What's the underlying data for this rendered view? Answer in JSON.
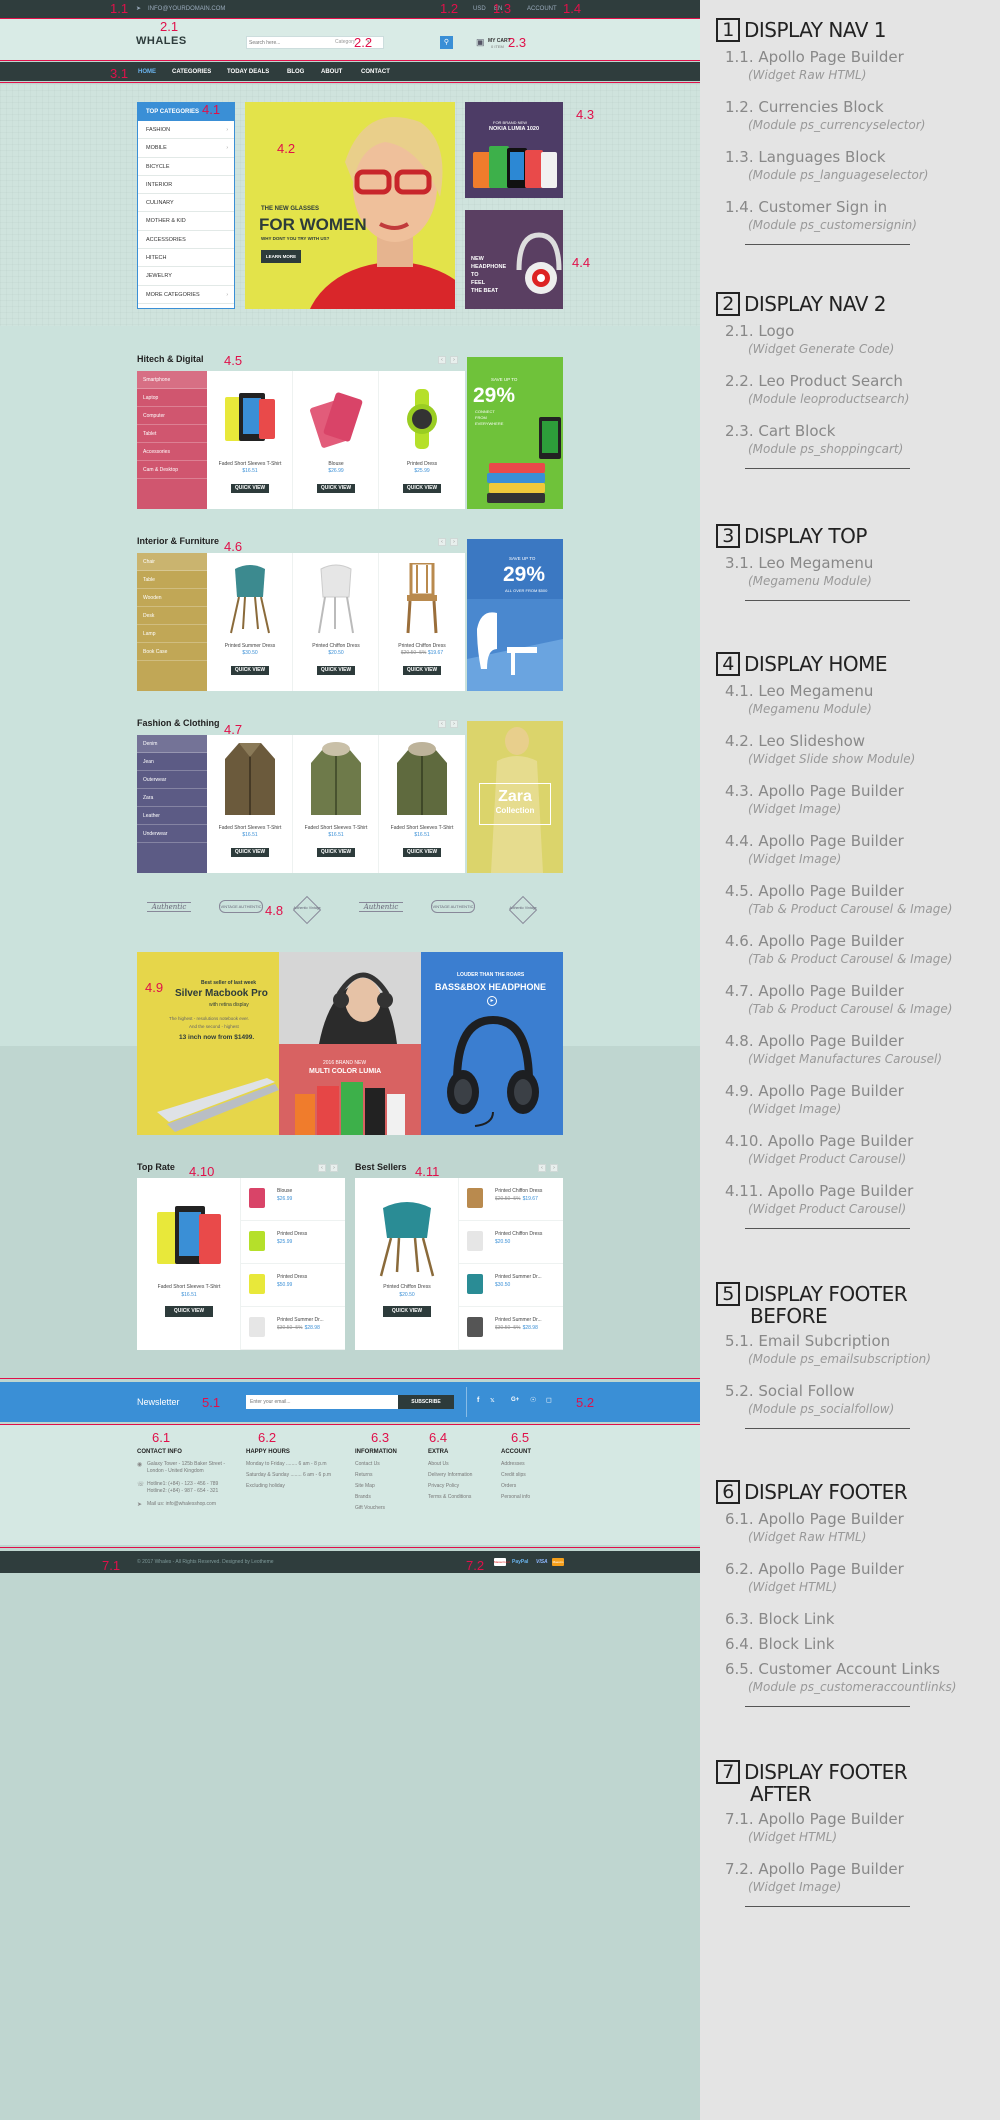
{
  "topbar": {
    "email": "INFO@YOURDOMAIN.COM",
    "currency": "USD",
    "language": "EN",
    "account": "ACCOUNT"
  },
  "header": {
    "logo": "WHALES",
    "search_placeholder": "Search here...",
    "category_label": "Category",
    "cart_label": "MY CART",
    "cart_count": "0 ITEM"
  },
  "menu": {
    "items": [
      "HOME",
      "CATEGORIES",
      "TODAY DEALS",
      "BLOG",
      "ABOUT",
      "CONTACT"
    ]
  },
  "top_categories": {
    "title": "TOP CATEGORIES",
    "items": [
      "FASHION",
      "MOBILE",
      "BICYCLE",
      "INTERIOR",
      "CULINARY",
      "MOTHER & KID",
      "ACCESSORIES",
      "HITECH",
      "JEWELRY",
      "MORE CATEGORIES"
    ]
  },
  "slide": {
    "kicker": "THE NEW GLASSES",
    "headline": "FOR WOMEN",
    "sub": "WHY DONT YOU TRY WITH US?",
    "button": "LEARN MORE"
  },
  "banner_nokia": {
    "kicker": "FOR BRAND NEW",
    "title": "NOKIA LUMIA 1020"
  },
  "banner_headphone": {
    "lines": [
      "NEW",
      "HEADPHONE",
      "TO",
      "FEEL",
      "THE BEAT"
    ]
  },
  "hitech": {
    "title": "Hitech & Digital",
    "cats": [
      "Smartphone",
      "Laptop",
      "Computer",
      "Tablet",
      "Accessories",
      "Cam & Desktop"
    ],
    "products": [
      {
        "name": "Faded Short Sleeves T-Shirt",
        "price": "$16.51"
      },
      {
        "name": "Blouse",
        "price": "$26.99"
      },
      {
        "name": "Printed Dress",
        "price": "$25.99"
      }
    ],
    "promo": {
      "kicker": "SAVE UP TO",
      "value": "29%",
      "sub": [
        "CONNECT",
        "FROM",
        "EVERYWHERE"
      ]
    }
  },
  "interior": {
    "title": "Interior & Furniture",
    "cats": [
      "Chair",
      "Table",
      "Wooden",
      "Desk",
      "Lamp",
      "Book Case"
    ],
    "products": [
      {
        "name": "Printed Summer Dress",
        "price": "$30.50"
      },
      {
        "name": "Printed Chiffon Dress",
        "price": "$20.50"
      },
      {
        "name": "Printed Chiffon Dress",
        "price": "$19.67",
        "old": "$20.50 -5%"
      }
    ],
    "promo": {
      "kicker": "SAVE UP TO",
      "value": "29%",
      "sub": [
        "ALL OVER FROM $500"
      ]
    }
  },
  "fashion": {
    "title": "Fashion & Clothing",
    "cats": [
      "Denim",
      "Jean",
      "Outerwear",
      "Zara",
      "Leather",
      "Underwear"
    ],
    "products": [
      {
        "name": "Faded Short Sleeves T-Shirt",
        "price": "$16.51"
      },
      {
        "name": "Faded Short Sleeves T-Shirt",
        "price": "$16.51"
      },
      {
        "name": "Faded Short Sleeves T-Shirt",
        "price": "$16.51"
      }
    ],
    "promo": {
      "line1": "Zara",
      "line2": "Collection"
    }
  },
  "quick_view": "QUICK VIEW",
  "manufacturers": [
    "Authentic",
    "VINTAGE AUTHENTIC",
    "Authentic Vintage",
    "Authentic",
    "VINTAGE AUTHENTIC",
    "Authentic Vintage"
  ],
  "banner_mac": {
    "kicker": "Best seller of last week",
    "title": "Silver Macbook Pro",
    "sub": "with retina display",
    "desc1": "The highest - resolutions notebook ever.",
    "desc2": "And the second - highest",
    "price_line": "13 inch now from $1499."
  },
  "banner_lumia": {
    "kicker": "2016 BRAND NEW",
    "title": "MULTI COLOR LUMIA"
  },
  "banner_bass": {
    "kicker": "LOUDER THAN THE ROARS",
    "title": "BASS&BOX HEADPHONE"
  },
  "top_rate": {
    "title": "Top Rate",
    "main": {
      "name": "Faded Short Sleeves T-Shirt",
      "price": "$16.51"
    },
    "list": [
      {
        "name": "Blouse",
        "price": "$26.99"
      },
      {
        "name": "Printed Dress",
        "price": "$25.99"
      },
      {
        "name": "Printed Dress",
        "price": "$50.99"
      },
      {
        "name": "Printed Summer Dr...",
        "price": "$28.98",
        "old": "$30.50 -5%"
      }
    ]
  },
  "best_sellers": {
    "title": "Best Sellers",
    "main": {
      "name": "Printed Chiffon Dress",
      "price": "$20.50"
    },
    "list": [
      {
        "name": "Printed Chiffon Dress",
        "price": "$19.67",
        "old": "$20.50 -5%"
      },
      {
        "name": "Printed Chiffon Dress",
        "price": "$20.50"
      },
      {
        "name": "Printed Summer Dr...",
        "price": "$30.50"
      },
      {
        "name": "Printed Summer Dr...",
        "price": "$28.98",
        "old": "$30.50 -5%"
      }
    ]
  },
  "newsletter": {
    "label": "Newsletter",
    "placeholder": "Enter your email...",
    "button": "SUBSCRIBE"
  },
  "footer": {
    "contact": {
      "title": "CONTACT INFO",
      "address": "Galaxy Tower - 125b Baker Street - London - United Kingdom",
      "phone1": "Hotline1: (+84) - 123 - 456 - 789",
      "phone2": "Hotline2: (+84) - 987 - 654 - 321",
      "mail": "Mail us: info@whalesshop.com"
    },
    "hours": {
      "title": "HAPPY HOURS",
      "rows": [
        "Monday to Friday ........ 6 am - 8 p.m",
        "Saturday & Sunday ........ 6 am - 6 p.m",
        "Excluding holiday"
      ]
    },
    "information": {
      "title": "INFORMATION",
      "links": [
        "Contact Us",
        "Returns",
        "Site Map",
        "Brands",
        "Gift Vouchers"
      ]
    },
    "extra": {
      "title": "EXTRA",
      "links": [
        "About Us",
        "Delivery Information",
        "Privacy Policy",
        "Terms & Conditions"
      ]
    },
    "account": {
      "title": "ACCOUNT",
      "links": [
        "Addresses",
        "Credit slips",
        "Orders",
        "Personal info"
      ]
    }
  },
  "bottom": {
    "copyright": "© 2017 Whales - All Rights Reserved. Designed by Leotheme",
    "payments": [
      "MasterCard",
      "PayPal",
      "VISA",
      "Maestro"
    ]
  },
  "annotations": [
    "1.1",
    "2.1",
    "1.2",
    "1.3",
    "1.4",
    "2.2",
    "2.3",
    "3.1",
    "4.1",
    "4.2",
    "4.3",
    "4.4",
    "4.5",
    "4.6",
    "4.7",
    "4.8",
    "4.9",
    "4.10",
    "4.11",
    "5.1",
    "5.2",
    "6.1",
    "6.2",
    "6.3",
    "6.4",
    "6.5",
    "7.1",
    "7.2"
  ],
  "sidebar": {
    "sections": [
      {
        "num": "1",
        "title": "DISPLAY NAV 1",
        "items": [
          {
            "name": "1.1. Apollo Page Builder",
            "sub": "(Widget Raw HTML)"
          },
          {
            "name": "1.2. Currencies Block",
            "sub": "(Module ps_currencyselector)"
          },
          {
            "name": "1.3. Languages Block",
            "sub": "(Module ps_languageselector)"
          },
          {
            "name": "1.4. Customer Sign in",
            "sub": "(Module ps_customersignin)"
          }
        ]
      },
      {
        "num": "2",
        "title": "DISPLAY NAV 2",
        "items": [
          {
            "name": "2.1. Logo",
            "sub": "(Widget Generate Code)"
          },
          {
            "name": "2.2. Leo Product Search",
            "sub": "(Module leoproductsearch)"
          },
          {
            "name": "2.3. Cart Block",
            "sub": "(Module ps_shoppingcart)"
          }
        ]
      },
      {
        "num": "3",
        "title": "DISPLAY TOP",
        "items": [
          {
            "name": "3.1. Leo Megamenu",
            "sub": "(Megamenu Module)"
          }
        ]
      },
      {
        "num": "4",
        "title": "DISPLAY HOME",
        "items": [
          {
            "name": "4.1. Leo Megamenu",
            "sub": "(Megamenu Module)"
          },
          {
            "name": "4.2. Leo Slideshow",
            "sub": "(Widget Slide show Module)"
          },
          {
            "name": "4.3. Apollo Page Builder",
            "sub": "(Widget Image)"
          },
          {
            "name": "4.4. Apollo Page Builder",
            "sub": "(Widget Image)"
          },
          {
            "name": "4.5. Apollo Page Builder",
            "sub": "(Tab & Product Carousel & Image)"
          },
          {
            "name": "4.6. Apollo Page Builder",
            "sub": "(Tab & Product Carousel & Image)"
          },
          {
            "name": "4.7. Apollo Page Builder",
            "sub": "(Tab & Product Carousel & Image)"
          },
          {
            "name": "4.8. Apollo Page Builder",
            "sub": "(Widget Manufactures Carousel)"
          },
          {
            "name": "4.9. Apollo Page Builder",
            "sub": "(Widget Image)"
          },
          {
            "name": "4.10. Apollo Page Builder",
            "sub": "(Widget Product Carousel)"
          },
          {
            "name": "4.11. Apollo Page Builder",
            "sub": "(Widget Product Carousel)"
          }
        ]
      },
      {
        "num": "5",
        "title": "DISPLAY FOOTER BEFORE",
        "title1": "DISPLAY FOOTER",
        "title2": "BEFORE",
        "items": [
          {
            "name": "5.1. Email Subcription",
            "sub": "(Module ps_emailsubscription)"
          },
          {
            "name": "5.2. Social Follow",
            "sub": "(Module ps_socialfollow)"
          }
        ]
      },
      {
        "num": "6",
        "title": "DISPLAY FOOTER",
        "items": [
          {
            "name": "6.1. Apollo Page Builder",
            "sub": "(Widget Raw HTML)"
          },
          {
            "name": "6.2. Apollo Page Builder",
            "sub": "(Widget HTML)"
          },
          {
            "name": "6.3. Block Link",
            "sub": ""
          },
          {
            "name": "6.4. Block Link",
            "sub": ""
          },
          {
            "name": "6.5. Customer Account Links",
            "sub": "(Module ps_customeraccountlinks)"
          }
        ]
      },
      {
        "num": "7",
        "title": "DISPLAY FOOTER AFTER",
        "title1": "DISPLAY FOOTER",
        "title2": "AFTER",
        "items": [
          {
            "name": "7.1. Apollo Page Builder",
            "sub": "(Widget HTML)"
          },
          {
            "name": "7.2. Apollo Page Builder",
            "sub": "(Widget Image)"
          }
        ]
      }
    ]
  },
  "colors": {
    "accent": "#3a8fd6",
    "annotation": "#e0104a",
    "dark": "#2d3b3b",
    "page_bg": "#bfd6d0"
  }
}
